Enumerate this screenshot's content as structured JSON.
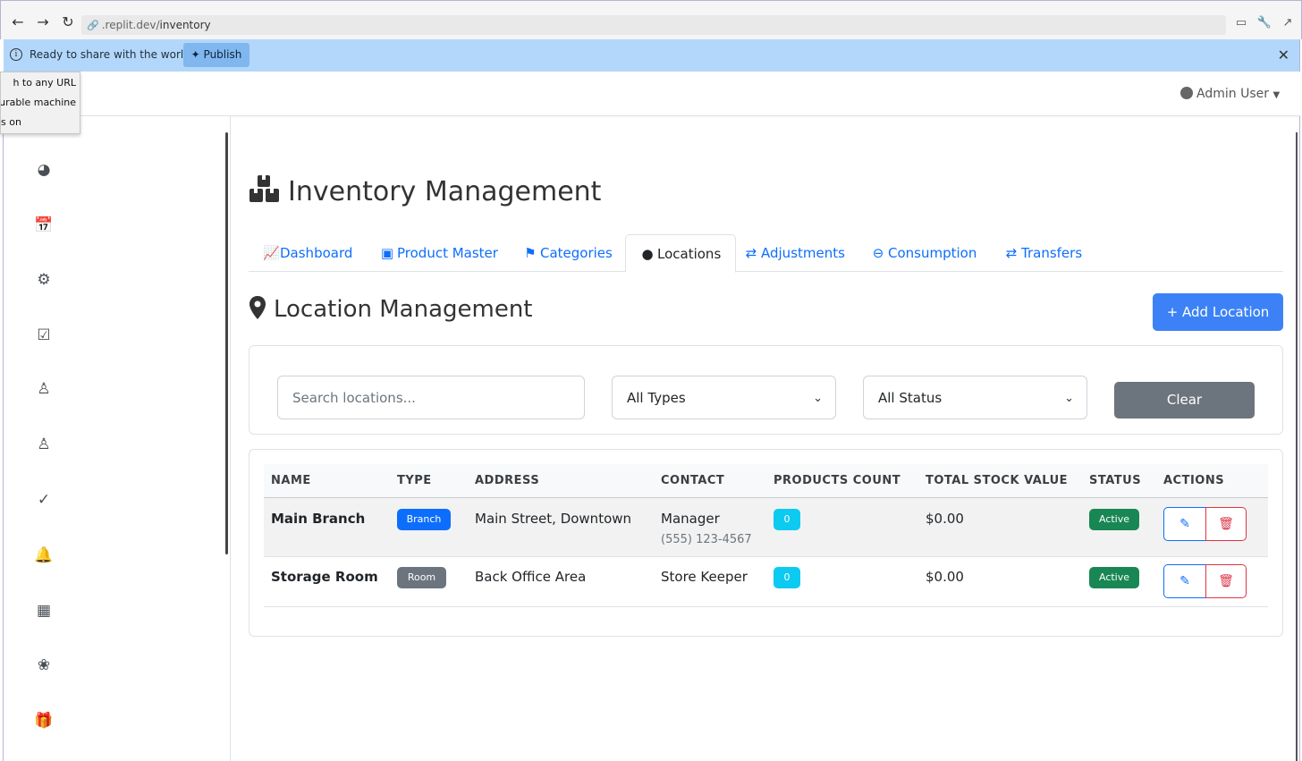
{
  "browser": {
    "url_prefix": ".replit.dev/",
    "url_path": "inventory"
  },
  "banner": {
    "message": "Ready to share with the world?",
    "publish_label": "Publish"
  },
  "tooltip": {
    "lines": [
      "h to any URL",
      "gurable machine",
      "s on"
    ]
  },
  "header": {
    "user_label": "Admin User"
  },
  "sidebar": {
    "icons": [
      "dashboard-gauge-icon",
      "calendar-icon",
      "users-gear-icon",
      "calendar-check-icon",
      "users-icon",
      "users-group-icon",
      "user-check-icon",
      "bell-icon",
      "cash-register-icon",
      "spa-icon",
      "gift-icon"
    ]
  },
  "page": {
    "title": "Inventory Management"
  },
  "tabs": [
    {
      "label": "Dashboard",
      "icon": "chart-line-icon",
      "active": false
    },
    {
      "label": "Product Master",
      "icon": "box-icon",
      "active": false
    },
    {
      "label": "Categories",
      "icon": "tags-icon",
      "active": false
    },
    {
      "label": "Locations",
      "icon": "map-marker-icon",
      "active": true
    },
    {
      "label": "Adjustments",
      "icon": "exchange-icon",
      "active": false
    },
    {
      "label": "Consumption",
      "icon": "minus-circle-icon",
      "active": false
    },
    {
      "label": "Transfers",
      "icon": "exchange-icon",
      "active": false
    }
  ],
  "section": {
    "title": "Location Management",
    "add_label": "+ Add Location"
  },
  "filters": {
    "search_placeholder": "Search locations...",
    "type_selected": "All Types",
    "status_selected": "All Status",
    "clear_label": "Clear"
  },
  "table": {
    "columns": [
      "NAME",
      "TYPE",
      "ADDRESS",
      "CONTACT",
      "PRODUCTS COUNT",
      "TOTAL STOCK VALUE",
      "STATUS",
      "ACTIONS"
    ],
    "rows": [
      {
        "name": "Main Branch",
        "type": "Branch",
        "type_color": "#0d6efd",
        "address": "Main Street, Downtown",
        "contact": "Manager",
        "phone": "(555) 123-4567",
        "products_count": "0",
        "stock_value": "$0.00",
        "status": "Active"
      },
      {
        "name": "Storage Room",
        "type": "Room",
        "type_color": "#6c757d",
        "address": "Back Office Area",
        "contact": "Store Keeper",
        "phone": "",
        "products_count": "0",
        "stock_value": "$0.00",
        "status": "Active"
      }
    ]
  },
  "colors": {
    "primary": "#0d6efd",
    "add_button": "#3c82f6",
    "secondary": "#6c757d",
    "info": "#0dcaf0",
    "success": "#198754",
    "danger": "#dc3545",
    "banner": "#b3d7fb"
  }
}
